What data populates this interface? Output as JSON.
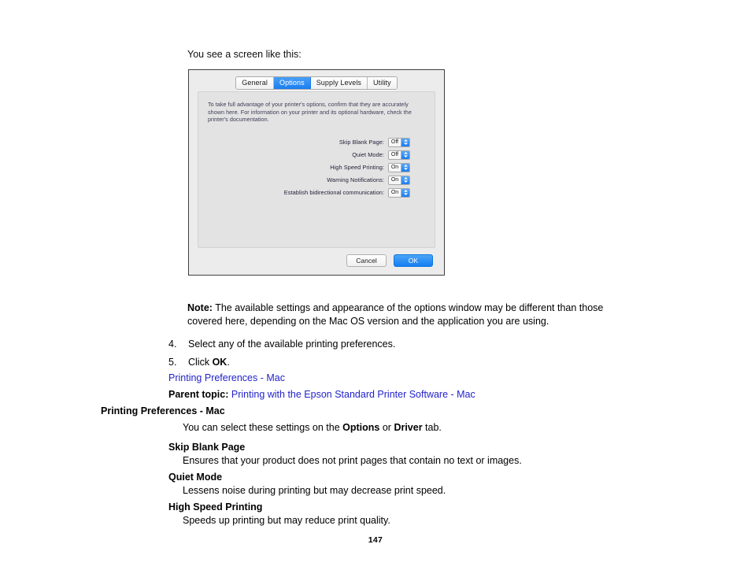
{
  "lead_in": "You see a screen like this:",
  "dialog": {
    "tabs": [
      {
        "label": "General",
        "active": false
      },
      {
        "label": "Options",
        "active": true
      },
      {
        "label": "Supply Levels",
        "active": false
      },
      {
        "label": "Utility",
        "active": false
      }
    ],
    "description": "To take full advantage of your printer's options, confirm that they are accurately shown here. For information on your printer and its optional hardware, check the printer's documentation.",
    "settings": [
      {
        "label": "Skip Blank Page:",
        "value": "Off"
      },
      {
        "label": "Quiet Mode:",
        "value": "Off"
      },
      {
        "label": "High Speed Printing:",
        "value": "On"
      },
      {
        "label": "Warning Notifications:",
        "value": "On"
      },
      {
        "label": "Establish bidirectional communication:",
        "value": "On"
      }
    ],
    "buttons": {
      "cancel": "Cancel",
      "ok": "OK"
    },
    "accent_color": "#1a7ef0"
  },
  "note": {
    "label": "Note:",
    "text": " The available settings and appearance of the options window may be different than those covered here, depending on the Mac OS version and the application you are using."
  },
  "steps": [
    {
      "num": "4.",
      "text": "Select any of the available printing preferences.",
      "bold_tail": ""
    },
    {
      "num": "5.",
      "text": "Click ",
      "bold_tail": "OK",
      "suffix": "."
    }
  ],
  "links": {
    "printing_preferences_mac": "Printing Preferences - Mac",
    "parent_topic_label": "Parent topic:",
    "parent_topic_link": "Printing with the Epson Standard Printer Software - Mac",
    "link_color": "#2222cc"
  },
  "section": {
    "heading": "Printing Preferences - Mac",
    "intro_prefix": "You can select these settings on the ",
    "intro_bold1": "Options",
    "intro_middle": " or ",
    "intro_bold2": "Driver",
    "intro_suffix": " tab."
  },
  "terms": [
    {
      "term": "Skip Blank Page",
      "definition": "Ensures that your product does not print pages that contain no text or images."
    },
    {
      "term": "Quiet Mode",
      "definition": "Lessens noise during printing but may decrease print speed."
    },
    {
      "term": "High Speed Printing",
      "definition": "Speeds up printing but may reduce print quality."
    }
  ],
  "page_number": "147"
}
